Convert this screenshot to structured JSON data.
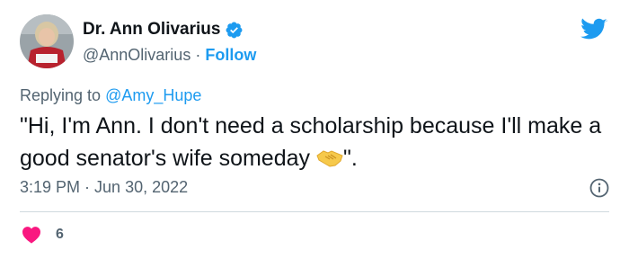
{
  "author": {
    "name": "Dr. Ann Olivarius",
    "handle": "@AnnOlivarius",
    "separator": " · ",
    "follow_label": "Follow"
  },
  "reply": {
    "prefix": "Replying to ",
    "handle": "@Amy_Hupe"
  },
  "tweet": {
    "text_before_emoji": "\"Hi, I'm Ann. I don't need a scholarship because I'll make a good senator's wife someday ",
    "emoji": "handshake",
    "text_after_emoji": "\".",
    "time": "3:19 PM",
    "separator": " · ",
    "date": "Jun 30, 2022"
  },
  "engagement": {
    "likes": "6"
  },
  "colors": {
    "brand_blue": "#1d9bf0",
    "text": "#0f1419",
    "secondary_text": "#536471",
    "like_pink": "#f91880",
    "divider": "#cfd9de"
  },
  "icons": [
    "verified-badge-icon",
    "twitter-bird-icon",
    "info-icon",
    "heart-icon",
    "handshake-emoji-icon"
  ]
}
